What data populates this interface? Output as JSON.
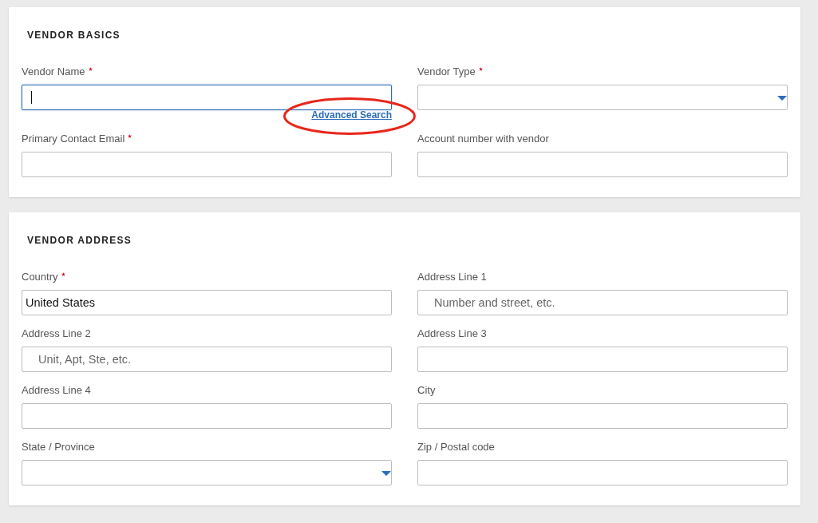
{
  "sections": [
    {
      "title": "VENDOR BASICS",
      "fields": [
        {
          "label": "Vendor Name",
          "required": true,
          "kind": "text",
          "focused": true,
          "link": {
            "label": "Advanced Search",
            "highlighted": true
          }
        },
        {
          "label": "Vendor Type",
          "required": true,
          "kind": "select",
          "focused": false
        },
        {
          "label": "Primary Contact Email",
          "required": true,
          "kind": "text",
          "focused": false
        },
        {
          "label": "Account number with vendor",
          "required": false,
          "kind": "text",
          "focused": false
        }
      ]
    },
    {
      "title": "VENDOR ADDRESS",
      "fields": [
        {
          "label": "Country",
          "required": true,
          "kind": "text",
          "focused": false,
          "value": "United States"
        },
        {
          "label": "Address Line 1",
          "required": false,
          "kind": "text",
          "focused": false,
          "placeholder": "Number and street, etc."
        },
        {
          "label": "Address Line 2",
          "required": false,
          "kind": "text",
          "focused": false,
          "placeholder": "Unit, Apt, Ste, etc."
        },
        {
          "label": "Address Line 3",
          "required": false,
          "kind": "text",
          "focused": false
        },
        {
          "label": "Address Line 4",
          "required": false,
          "kind": "text",
          "focused": false
        },
        {
          "label": "City",
          "required": false,
          "kind": "text",
          "focused": false
        },
        {
          "label": "State / Province",
          "required": false,
          "kind": "select",
          "focused": false
        },
        {
          "label": "Zip / Postal code",
          "required": false,
          "kind": "text",
          "focused": false
        }
      ]
    }
  ]
}
